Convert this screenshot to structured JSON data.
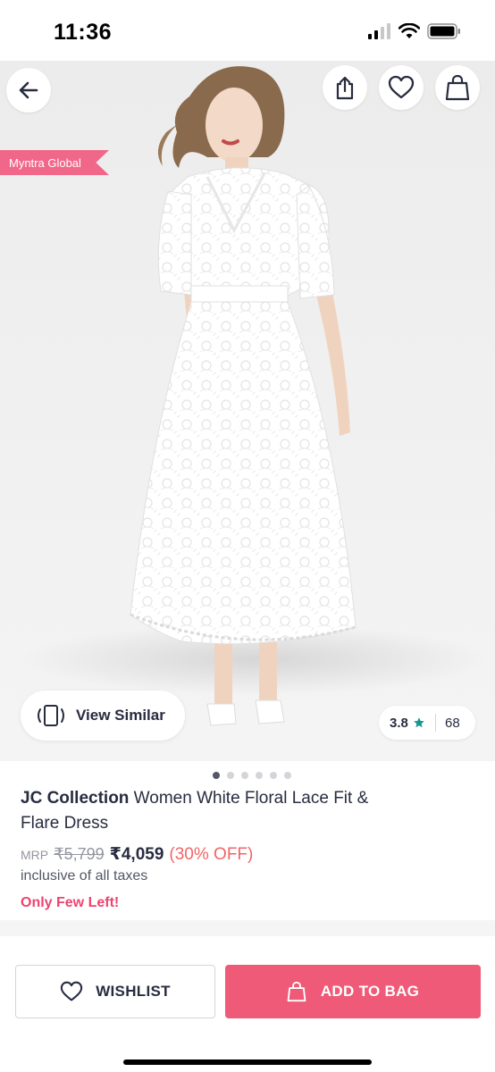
{
  "status_bar": {
    "time": "11:36"
  },
  "badge": {
    "label": "Myntra Global"
  },
  "actions": {
    "view_similar": "View Similar"
  },
  "rating": {
    "value": "3.8",
    "count": "68"
  },
  "gallery": {
    "image_count": 6,
    "active_index": 0
  },
  "product": {
    "brand": "JC Collection",
    "name": " Women White Floral Lace Fit & Flare Dress",
    "mrp_label": "MRP",
    "mrp": "₹5,799",
    "price": "₹4,059",
    "discount": "(30% OFF)",
    "tax_note": "inclusive of all taxes",
    "stock_note": "Only Few Left!"
  },
  "footer": {
    "wishlist_label": "WISHLIST",
    "add_to_bag_label": "ADD TO BAG"
  },
  "colors": {
    "accent": "#ee5a78",
    "discount": "#f16565",
    "ribbon": "#f0678a",
    "rating_star": "#14958f"
  },
  "icons": [
    "back-arrow-icon",
    "share-icon",
    "heart-icon",
    "bag-icon",
    "view-similar-icon",
    "star-icon"
  ]
}
